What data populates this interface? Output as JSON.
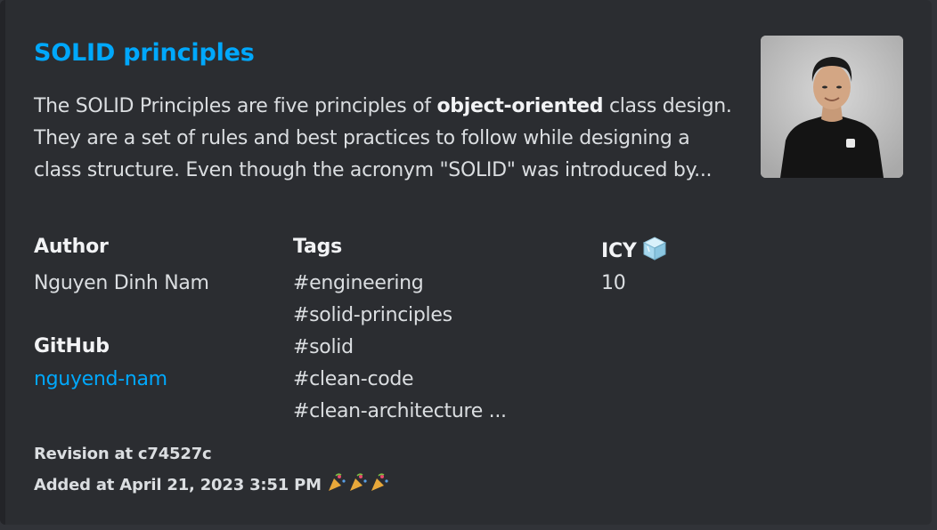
{
  "embed": {
    "title": "SOLID principles",
    "description": {
      "before": "The SOLID Principles are five principles of ",
      "bold": "object-oriented",
      "after": " class design. They are a set of rules and best practices to follow while designing a class structure. Even though the acronym \"SOLID\" was introduced by..."
    },
    "fields": {
      "author": {
        "name": "Author",
        "value": "Nguyen Dinh Nam"
      },
      "tags": {
        "name": "Tags",
        "values": [
          "#engineering",
          "#solid-principles",
          "#solid",
          "#clean-code",
          "#clean-architecture ..."
        ]
      },
      "icy": {
        "name": "ICY",
        "emoji": "ice-cube-icon",
        "value": "10"
      },
      "github": {
        "name": "GitHub",
        "value": "nguyend-nam"
      }
    },
    "footer": {
      "revision": "Revision at c74527c",
      "added": "Added at April 21, 2023 3:51 PM",
      "emoji": "party-popper-icon"
    },
    "thumbnail": "author-avatar-photo"
  },
  "colors": {
    "background": "#313338",
    "embed_bg": "#2b2d31",
    "link": "#00a8fc",
    "text": "#dbdee1"
  }
}
